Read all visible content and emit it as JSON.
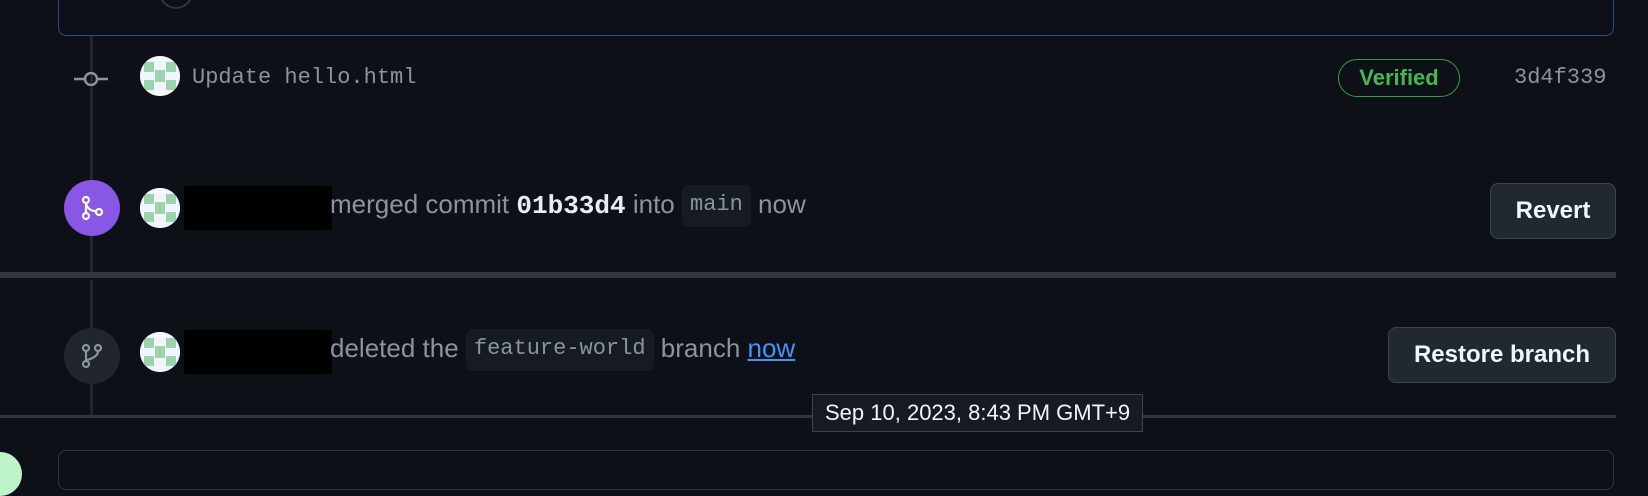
{
  "commit": {
    "message": "Update hello.html",
    "verified_label": "Verified",
    "sha": "3d4f339"
  },
  "merge_event": {
    "action": "merged commit",
    "commit_sha": "01b33d4",
    "into": "into",
    "branch": "main",
    "time": "now",
    "revert_label": "Revert"
  },
  "delete_event": {
    "action": "deleted the",
    "branch": "feature-world",
    "suffix": "branch",
    "time": "now",
    "restore_label": "Restore branch"
  },
  "tooltip": {
    "text": "Sep 10, 2023, 8:43 PM GMT+9"
  },
  "colors": {
    "background": "#0d1117",
    "merged_purple": "#8957e5",
    "verified_green": "#3fb950",
    "link_blue": "#4493f8"
  }
}
